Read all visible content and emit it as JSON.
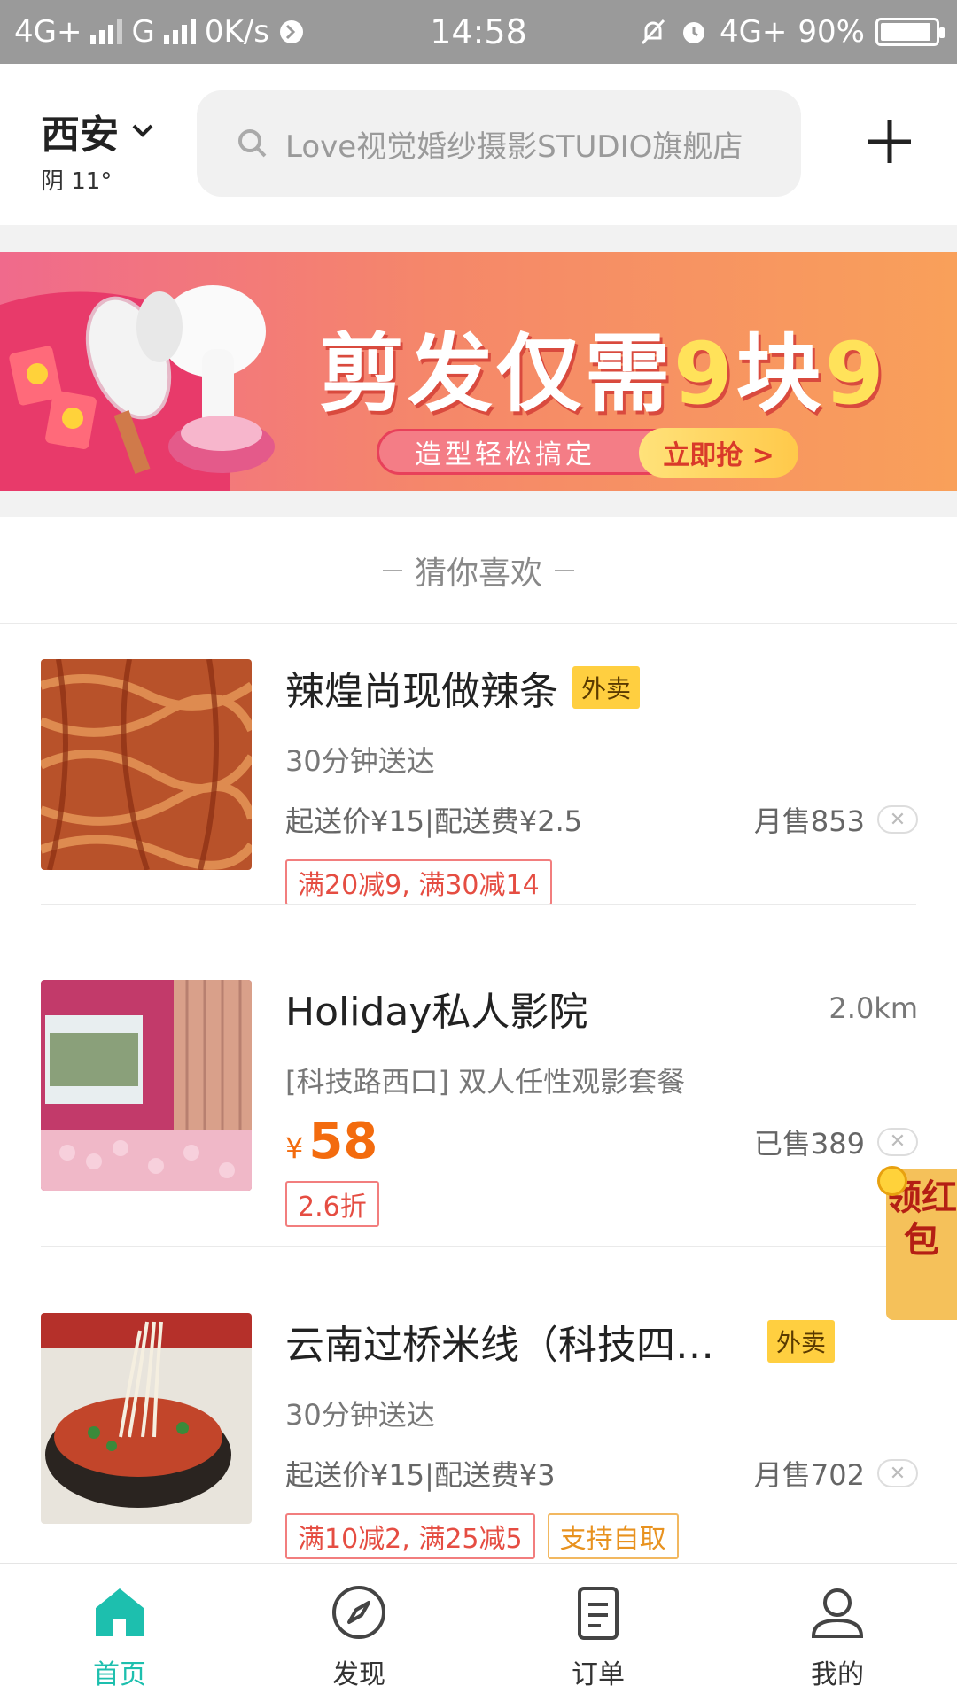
{
  "status_bar": {
    "network_left": "4G+",
    "network_g": "G",
    "speed": "0K/s",
    "time": "14:58",
    "network_right": "4G+",
    "battery": "90%"
  },
  "header": {
    "city": "西安",
    "weather": "阴 11°",
    "search_placeholder": "Love视觉婚纱摄影STUDIO旗舰店"
  },
  "banner": {
    "title_prefix": "剪发仅需",
    "title_9a": "9",
    "title_mid": "块",
    "title_9b": "9",
    "subtitle": "造型轻松搞定",
    "cta": "立即抢 >"
  },
  "recommend": {
    "heading": "猜你喜欢",
    "items": [
      {
        "title": "辣煌尚现做辣条",
        "tag": "外卖",
        "line2": "30分钟送达",
        "line3_left": "起送价¥15|配送费¥2.5",
        "line3_right": "月售853",
        "promos": [
          "满20减9, 满30减14"
        ]
      },
      {
        "title": "Holiday私人影院",
        "distance": "2.0km",
        "line2": "[科技路西口] 双人任性观影套餐",
        "price_symbol": "¥",
        "price": "58",
        "line3_right": "已售389",
        "promos": [
          "2.6折"
        ]
      },
      {
        "title": "云南过桥米线（科技四…",
        "tag": "外卖",
        "line2": "30分钟送达",
        "line3_left": "起送价¥15|配送费¥3",
        "line3_right": "月售702",
        "promos": [
          "满10减2, 满25减5",
          "支持自取"
        ]
      }
    ]
  },
  "red_packet": "领红包",
  "bottom_nav": [
    {
      "label": "首页",
      "icon": "home-icon",
      "active": true
    },
    {
      "label": "发现",
      "icon": "compass-icon",
      "active": false
    },
    {
      "label": "订单",
      "icon": "order-icon",
      "active": false
    },
    {
      "label": "我的",
      "icon": "profile-icon",
      "active": false
    }
  ],
  "colors": {
    "accent": "#1dbfae",
    "price": "#f36b0e",
    "promo_red": "#e54d42",
    "tag_yellow": "#ffcf40"
  }
}
